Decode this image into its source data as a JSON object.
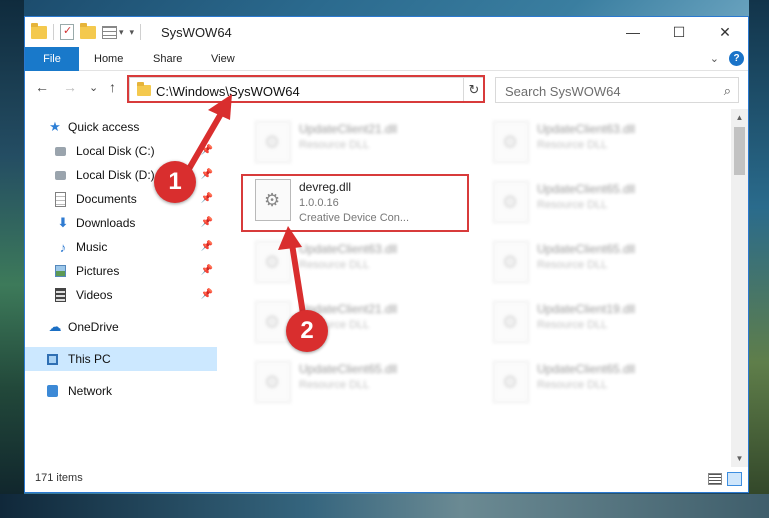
{
  "window": {
    "title": "SysWOW64",
    "minimize_glyph": "—",
    "maximize_glyph": "☐",
    "close_glyph": "✕"
  },
  "ribbon": {
    "tabs": [
      "File",
      "Home",
      "Share",
      "View"
    ]
  },
  "nav": {
    "back_glyph": "←",
    "forward_glyph": "→",
    "recent_glyph": "⌄",
    "up_glyph": "↑",
    "address_path": "C:\\Windows\\SysWOW64",
    "search_placeholder": "Search SysWOW64"
  },
  "sidebar": {
    "items": [
      {
        "label": "Quick access",
        "icon": "star-icon"
      },
      {
        "label": "Local Disk (C:)",
        "icon": "drive-icon",
        "pinned": true
      },
      {
        "label": "Local Disk (D:)",
        "icon": "drive-icon",
        "pinned": true
      },
      {
        "label": "Documents",
        "icon": "documents-icon",
        "pinned": true
      },
      {
        "label": "Downloads",
        "icon": "downloads-icon",
        "pinned": true
      },
      {
        "label": "Music",
        "icon": "music-icon",
        "pinned": true
      },
      {
        "label": "Pictures",
        "icon": "pictures-icon",
        "pinned": true
      },
      {
        "label": "Videos",
        "icon": "videos-icon",
        "pinned": true
      },
      {
        "label": "OneDrive",
        "icon": "cloud-icon"
      },
      {
        "label": "This PC",
        "icon": "computer-icon",
        "selected": true
      },
      {
        "label": "Network",
        "icon": "network-icon"
      }
    ]
  },
  "files": {
    "highlighted": {
      "name": "devreg.dll",
      "version": "1.0.0.16",
      "description": "Creative Device Con..."
    },
    "blurred": [
      {
        "name": "UpdateClient21.dll",
        "type": "Resource DLL"
      },
      {
        "name": "UpdateClient63.dll",
        "type": "Resource DLL"
      },
      {
        "name": "UpdateClient65.dll",
        "type": "Resource DLL"
      },
      {
        "name": "UpdateClient63.dll",
        "type": "Resource DLL"
      },
      {
        "name": "UpdateClient65.dll",
        "type": "Resource DLL"
      },
      {
        "name": "UpdateClient21.dll",
        "type": "Resource DLL"
      },
      {
        "name": "UpdateClient19.dll",
        "type": "Resource DLL"
      },
      {
        "name": "UpdateClient65.dll",
        "type": "Resource DLL"
      },
      {
        "name": "UpdateClient65.dll",
        "type": "Resource DLL"
      }
    ]
  },
  "status": {
    "item_count": "171 items"
  },
  "callouts": {
    "step1": "1",
    "step2": "2",
    "color": "#d92e2e"
  }
}
